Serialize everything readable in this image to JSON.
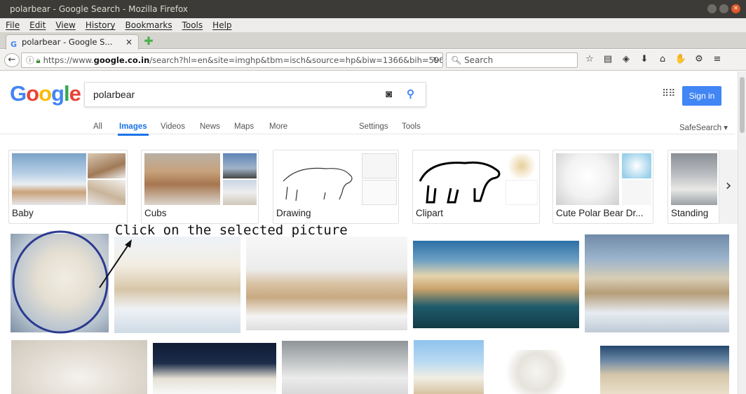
{
  "window": {
    "title": "polarbear - Google Search - Mozilla Firefox"
  },
  "menu": [
    "File",
    "Edit",
    "View",
    "History",
    "Bookmarks",
    "Tools",
    "Help"
  ],
  "tab": {
    "title": "polarbear - Google S...",
    "close": "×"
  },
  "nav": {
    "url_pre": "https://www.",
    "url_host": "google.co.in",
    "url_post": "/search?hl=en&site=imghp&tbm=isch&source=hp&biw=1366&bih=596&q=",
    "search_placeholder": "Search"
  },
  "google": {
    "logo": [
      "G",
      "o",
      "o",
      "g",
      "l",
      "e"
    ],
    "query": "polarbear",
    "signin": "Sign in",
    "tabs": [
      "All",
      "Images",
      "Videos",
      "News",
      "Maps",
      "More",
      "Settings",
      "Tools"
    ],
    "safesearch": "SafeSearch ▾"
  },
  "related": [
    "Baby",
    "Cubs",
    "Drawing",
    "Clipart",
    "Cute Polar Bear Dr...",
    "Standing"
  ],
  "annotation": "Click on the selected picture"
}
